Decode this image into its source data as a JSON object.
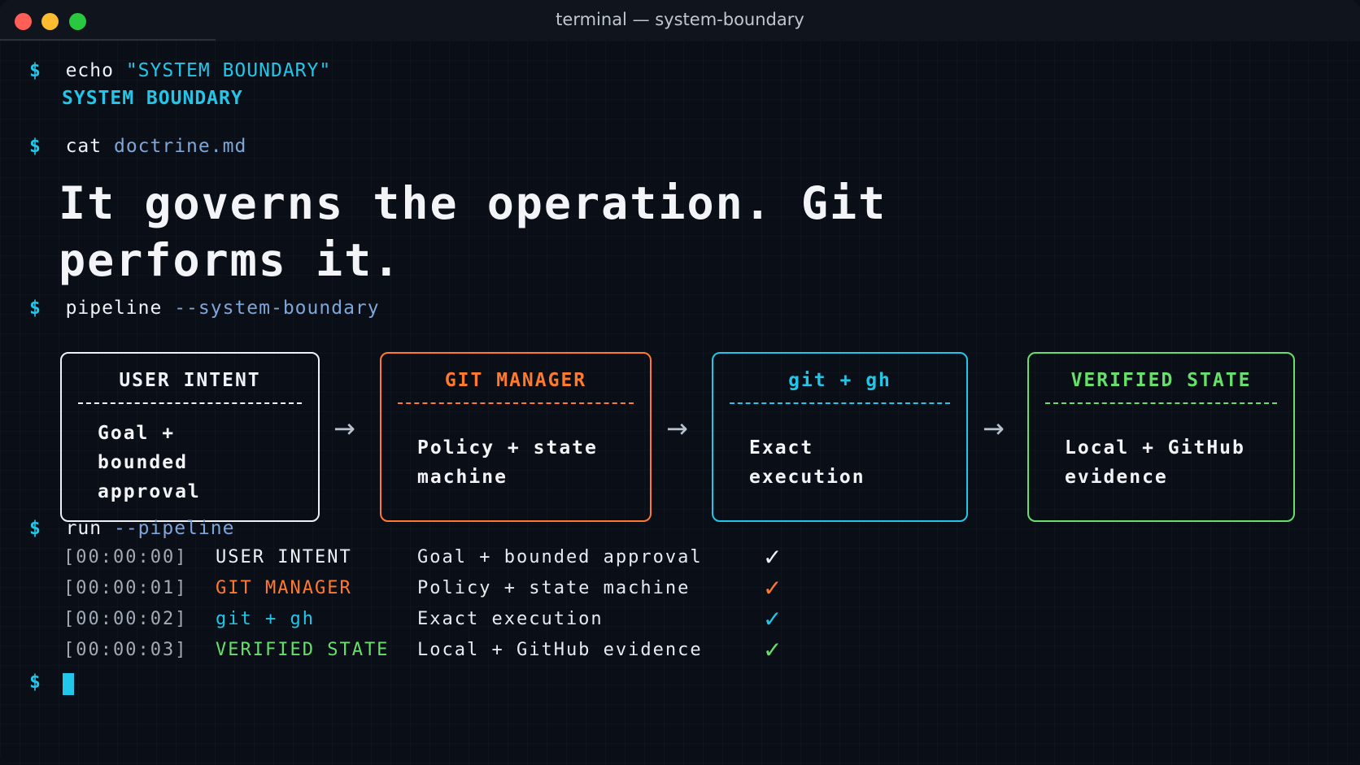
{
  "window": {
    "title": "terminal — system-boundary"
  },
  "prompt_symbol": "$",
  "commands": {
    "echo": {
      "cmd": "echo",
      "arg": "\"SYSTEM BOUNDARY\"",
      "output": "SYSTEM BOUNDARY"
    },
    "cat": {
      "cmd": "cat",
      "arg": "doctrine.md",
      "output_line1": "It governs the operation. Git",
      "output_line2": "performs it."
    },
    "pipeline": {
      "cmd": "pipeline",
      "arg": "--system-boundary"
    },
    "run": {
      "cmd": "run",
      "arg": "--pipeline"
    }
  },
  "pipeline_boxes": [
    {
      "title": "USER INTENT",
      "separator": "----------------",
      "body": "Goal +\nbounded\napproval",
      "color": "#eef1f5"
    },
    {
      "title": "GIT MANAGER",
      "separator": "----------------",
      "body": "Policy + state\nmachine",
      "color": "#ff7a2f"
    },
    {
      "title": "git + gh",
      "separator": "----------------",
      "body": "Exact\nexecution",
      "color": "#22c6e8"
    },
    {
      "title": "VERIFIED STATE",
      "separator": "----------------",
      "body": "Local + GitHub\nevidence",
      "color": "#66e06b"
    }
  ],
  "arrow_glyph": "→",
  "run_log": [
    {
      "time": "[00:00:00]",
      "stage": "USER INTENT",
      "detail": "Goal + bounded approval",
      "status": "✓",
      "color": "#eef1f5"
    },
    {
      "time": "[00:00:01]",
      "stage": "GIT MANAGER",
      "detail": "Policy + state machine",
      "status": "✓",
      "color": "#ff7a2f"
    },
    {
      "time": "[00:00:02]",
      "stage": "git + gh",
      "detail": "Exact execution",
      "status": "✓",
      "color": "#22c6e8"
    },
    {
      "time": "[00:00:03]",
      "stage": "VERIFIED STATE",
      "detail": "Local + GitHub evidence",
      "status": "✓",
      "color": "#66e06b"
    }
  ]
}
